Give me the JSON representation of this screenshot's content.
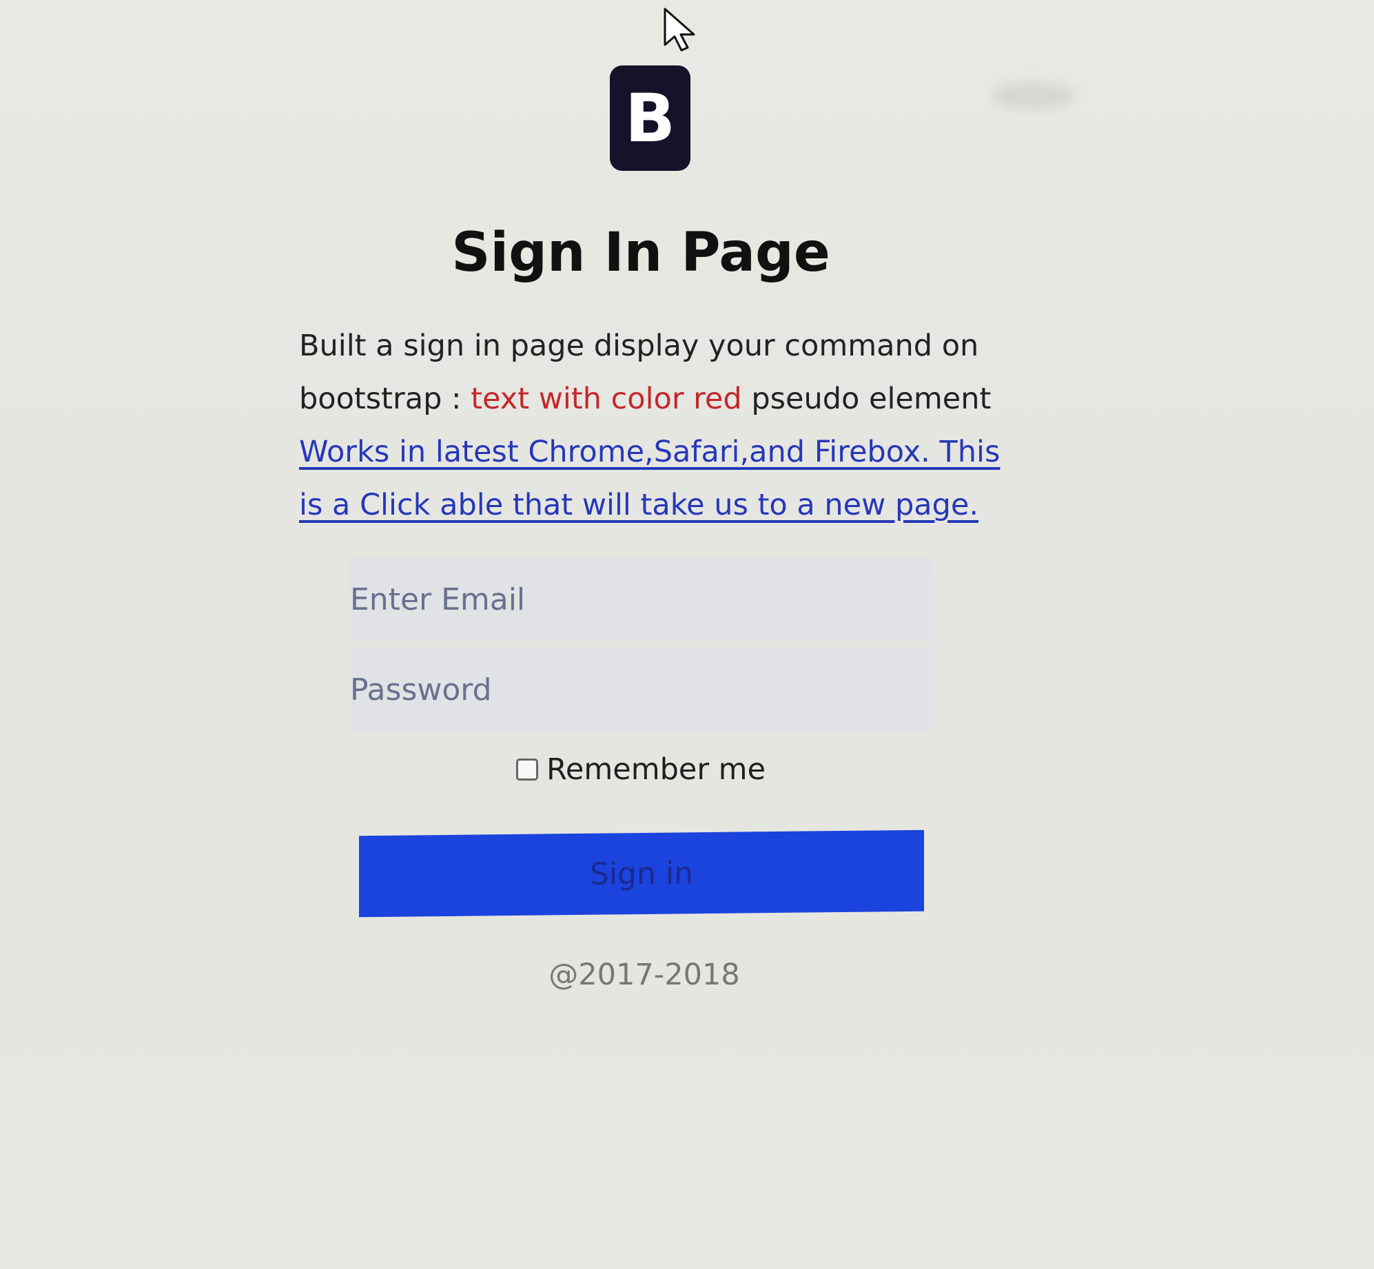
{
  "page": {
    "title": "Sign In Page",
    "logo_letter": "B",
    "description": {
      "line_1": "Built a sign in page display your command on",
      "prefix_2": "bootstrap : ",
      "red_text": "text with color red",
      "suffix_2": " pseudo element",
      "link_text": "Works in latest Chrome,Safari,and Firebox. This is a Click able that will take us to a new page."
    },
    "form": {
      "email_placeholder": "Enter Email",
      "password_placeholder": "Password",
      "remember_label": "Remember me",
      "remember_checked": false,
      "submit_label": "Sign in"
    },
    "footer": "@2017-2018"
  },
  "colors": {
    "background": "#e7e7e2",
    "logo": "#15132a",
    "red_text": "#c4272b",
    "link": "#2637b8",
    "button": "#1b43dd"
  },
  "icons": {
    "cursor": "mouse-pointer-icon",
    "logo": "bootstrap-logo-icon",
    "checkbox": "checkbox-icon"
  }
}
